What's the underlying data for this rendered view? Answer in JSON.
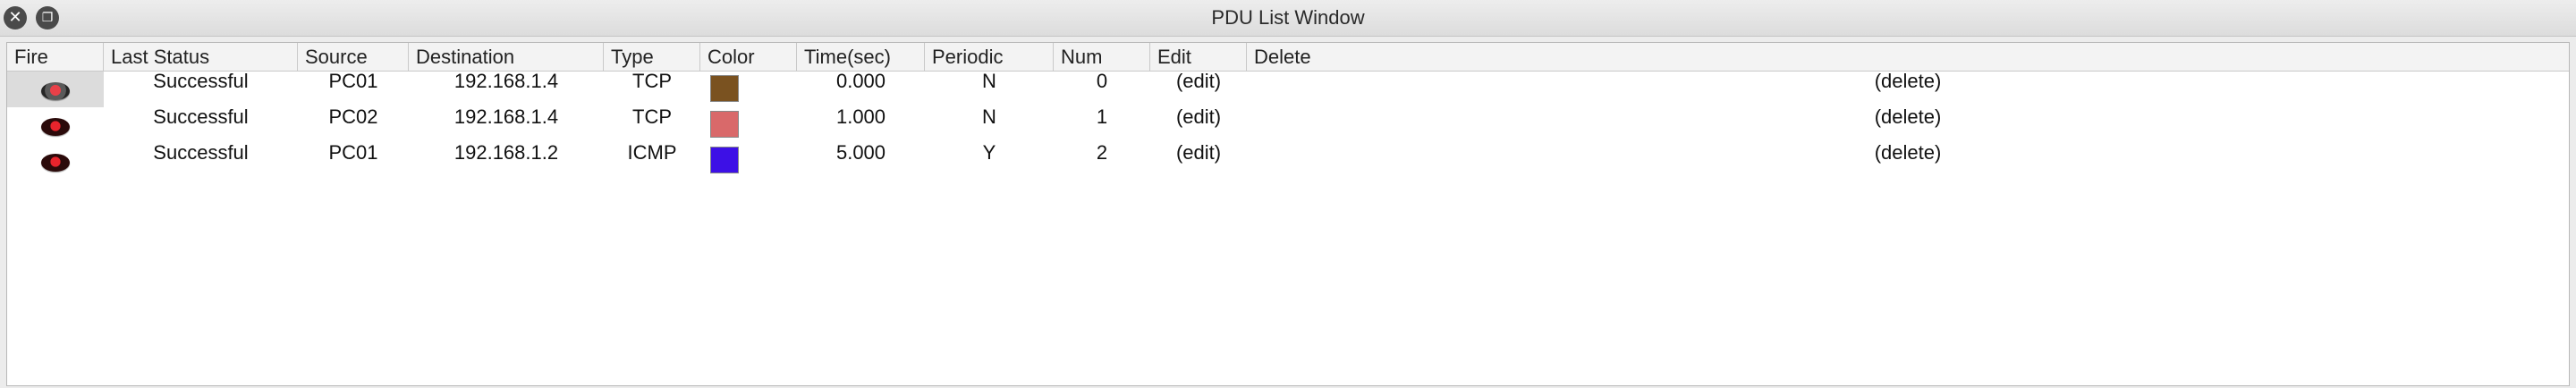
{
  "window": {
    "title": "PDU List Window"
  },
  "columns": [
    "Fire",
    "Last Status",
    "Source",
    "Destination",
    "Type",
    "Color",
    "Time(sec)",
    "Periodic",
    "Num",
    "Edit",
    "Delete"
  ],
  "rows": [
    {
      "status": "Successful",
      "source": "PC01",
      "destination": "192.168.1.4",
      "type": "TCP",
      "color": "#7a5220",
      "time": "0.000",
      "periodic": "N",
      "num": "0",
      "edit": "(edit)",
      "delete": "(delete)"
    },
    {
      "status": "Successful",
      "source": "PC02",
      "destination": "192.168.1.4",
      "type": "TCP",
      "color": "#d9696a",
      "time": "1.000",
      "periodic": "N",
      "num": "1",
      "edit": "(edit)",
      "delete": "(delete)"
    },
    {
      "status": "Successful",
      "source": "PC01",
      "destination": "192.168.1.2",
      "type": "ICMP",
      "color": "#3d10e6",
      "time": "5.000",
      "periodic": "Y",
      "num": "2",
      "edit": "(edit)",
      "delete": "(delete)"
    }
  ]
}
